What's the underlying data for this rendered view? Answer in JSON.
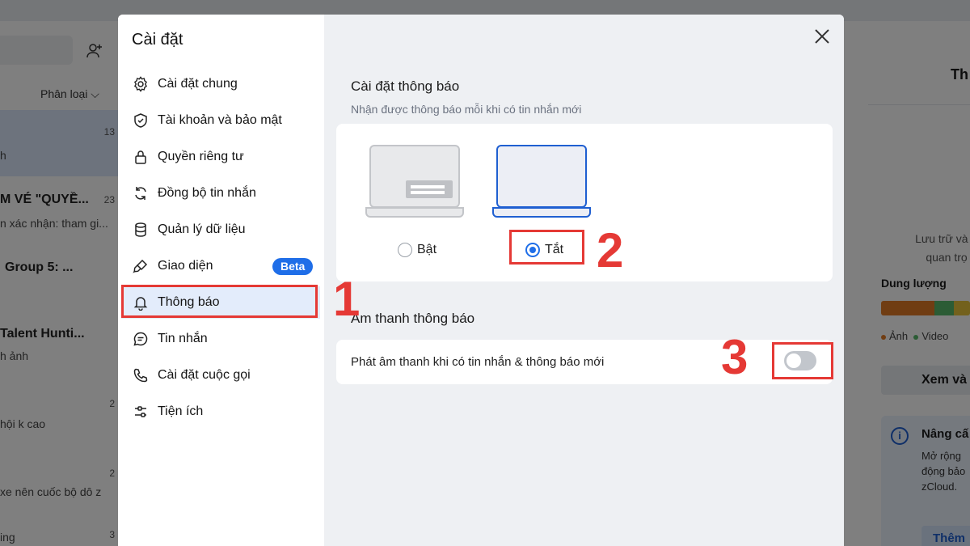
{
  "background": {
    "add_user_icon": "add-user-icon",
    "filter_label": "Phân loại",
    "chats": [
      {
        "title": "",
        "snippet": "h",
        "time": "13"
      },
      {
        "title": "M VÉ \"QUYỀ...",
        "snippet": "n xác nhận: tham gi...",
        "time": "23"
      },
      {
        "title": "Group 5: ...",
        "snippet": "",
        "time": ""
      },
      {
        "title": "Talent Hunti...",
        "snippet": "h ảnh",
        "time": ""
      },
      {
        "title": "",
        "snippet": "hội k cao",
        "time": "2"
      },
      {
        "title": "",
        "snippet": "xe nên cuốc bộ dô z",
        "time": "2"
      },
      {
        "title": "",
        "snippet": "ing",
        "time": "3"
      }
    ],
    "right_panel": {
      "header_partial": "Th",
      "storage_text": "Lưu trữ và tr quan trọ",
      "capacity_label": "Dung lượng",
      "legend": [
        "Ảnh",
        "Video"
      ],
      "view_button": "Xem và",
      "promo_title": "Nâng cấ",
      "promo_desc": "Mở rộng động bảo zCloud.",
      "promo_button": "Thêm"
    }
  },
  "settings": {
    "title": "Cài đặt",
    "nav": [
      {
        "label": "Cài đặt chung",
        "icon": "gear-icon"
      },
      {
        "label": "Tài khoản và bảo mật",
        "icon": "shield-icon"
      },
      {
        "label": "Quyền riêng tư",
        "icon": "lock-icon"
      },
      {
        "label": "Đồng bộ tin nhắn",
        "icon": "sync-icon"
      },
      {
        "label": "Quản lý dữ liệu",
        "icon": "database-icon"
      },
      {
        "label": "Giao diện",
        "icon": "paint-brush-icon",
        "badge": "Beta"
      },
      {
        "label": "Thông báo",
        "icon": "bell-icon",
        "active": true
      },
      {
        "label": "Tin nhắn",
        "icon": "chat-icon"
      },
      {
        "label": "Cài đặt cuộc gọi",
        "icon": "phone-icon"
      },
      {
        "label": "Tiện ích",
        "icon": "sliders-icon"
      }
    ],
    "notification": {
      "title": "Cài đặt thông báo",
      "subtitle": "Nhận được thông báo mỗi khi có tin nhắn mới",
      "option_on": "Bật",
      "option_off": "Tắt",
      "selected": "Tắt"
    },
    "sound": {
      "title": "Âm thanh thông báo",
      "row_label": "Phát âm thanh khi có tin nhắn & thông báo mới",
      "enabled": false
    }
  },
  "annotations": {
    "step1": "1",
    "step2": "2",
    "step3": "3"
  },
  "colors": {
    "accent": "#1f6ee8",
    "annotation": "#e53935",
    "active_nav": "#e3ecfb"
  }
}
